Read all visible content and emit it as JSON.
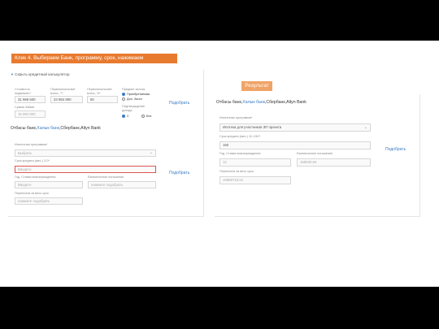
{
  "banner": "Клик 4. Выбираем Банк, программу, срок, нажимаем",
  "result_label": "Результат",
  "left": {
    "calc_toggle": "Скрыть кредитный калькулятор",
    "cost_label": "Стоимость недвижим.*",
    "cost_value": "31 969 600",
    "initial_label": "Первоначальный взнос, Т*",
    "initial_value": "23 984 800",
    "initial_pct_label": "Первоначальный взнос, %*",
    "initial_pct_value": "50",
    "subject_label": "Предмет залога",
    "subject_opt1": "Приобретаемая",
    "subject_opt2": "Доп. Залог",
    "confirm_label": "Подтверждение дохода",
    "confirm_opt1": "С",
    "confirm_opt2": "Без",
    "loan_label": "Сумма Займа",
    "loan_value": "15 984 800",
    "pick1": "Подобрать",
    "bank_prefix": "Отбасы банк,",
    "bank_link": "Халык банк",
    "bank_suffix": ",Сбербанк,Altyn Bank",
    "program_label": "Ипотечная программа*",
    "program_placeholder": "Выбрать",
    "term_label": "Срок кредита (мес.) 3-0*",
    "term_placeholder": "Введите",
    "rate_label": "Год. Ставка вознаграждения",
    "rate_placeholder": "Введите",
    "monthly_label": "Ежемесячное погашение",
    "monthly_placeholder": "нажмите подобрать",
    "pick2": "Подобрать",
    "overpay_label": "Переплата за весь срок",
    "overpay_placeholder": "нажмите подобрать"
  },
  "right": {
    "bank_prefix": "Отбасы банк,",
    "bank_link": "Халык банк",
    "bank_suffix": ",Сбербанк,Altyn Bank",
    "program_label": "Ипотечная программа*",
    "program_value": "Ипотека для участников ЗП проекта",
    "term_label": "Срок кредита (мес.) 12–240*",
    "term_value": "150",
    "pick": "Подобрать",
    "rate_label": "Год. Ставка вознаграждения",
    "rate_value": "12",
    "monthly_label": "Ежемесячное погашение",
    "monthly_value": "159030.84",
    "overpay_label": "Переплата за весь срок",
    "overpay_value": "19969715.91"
  }
}
